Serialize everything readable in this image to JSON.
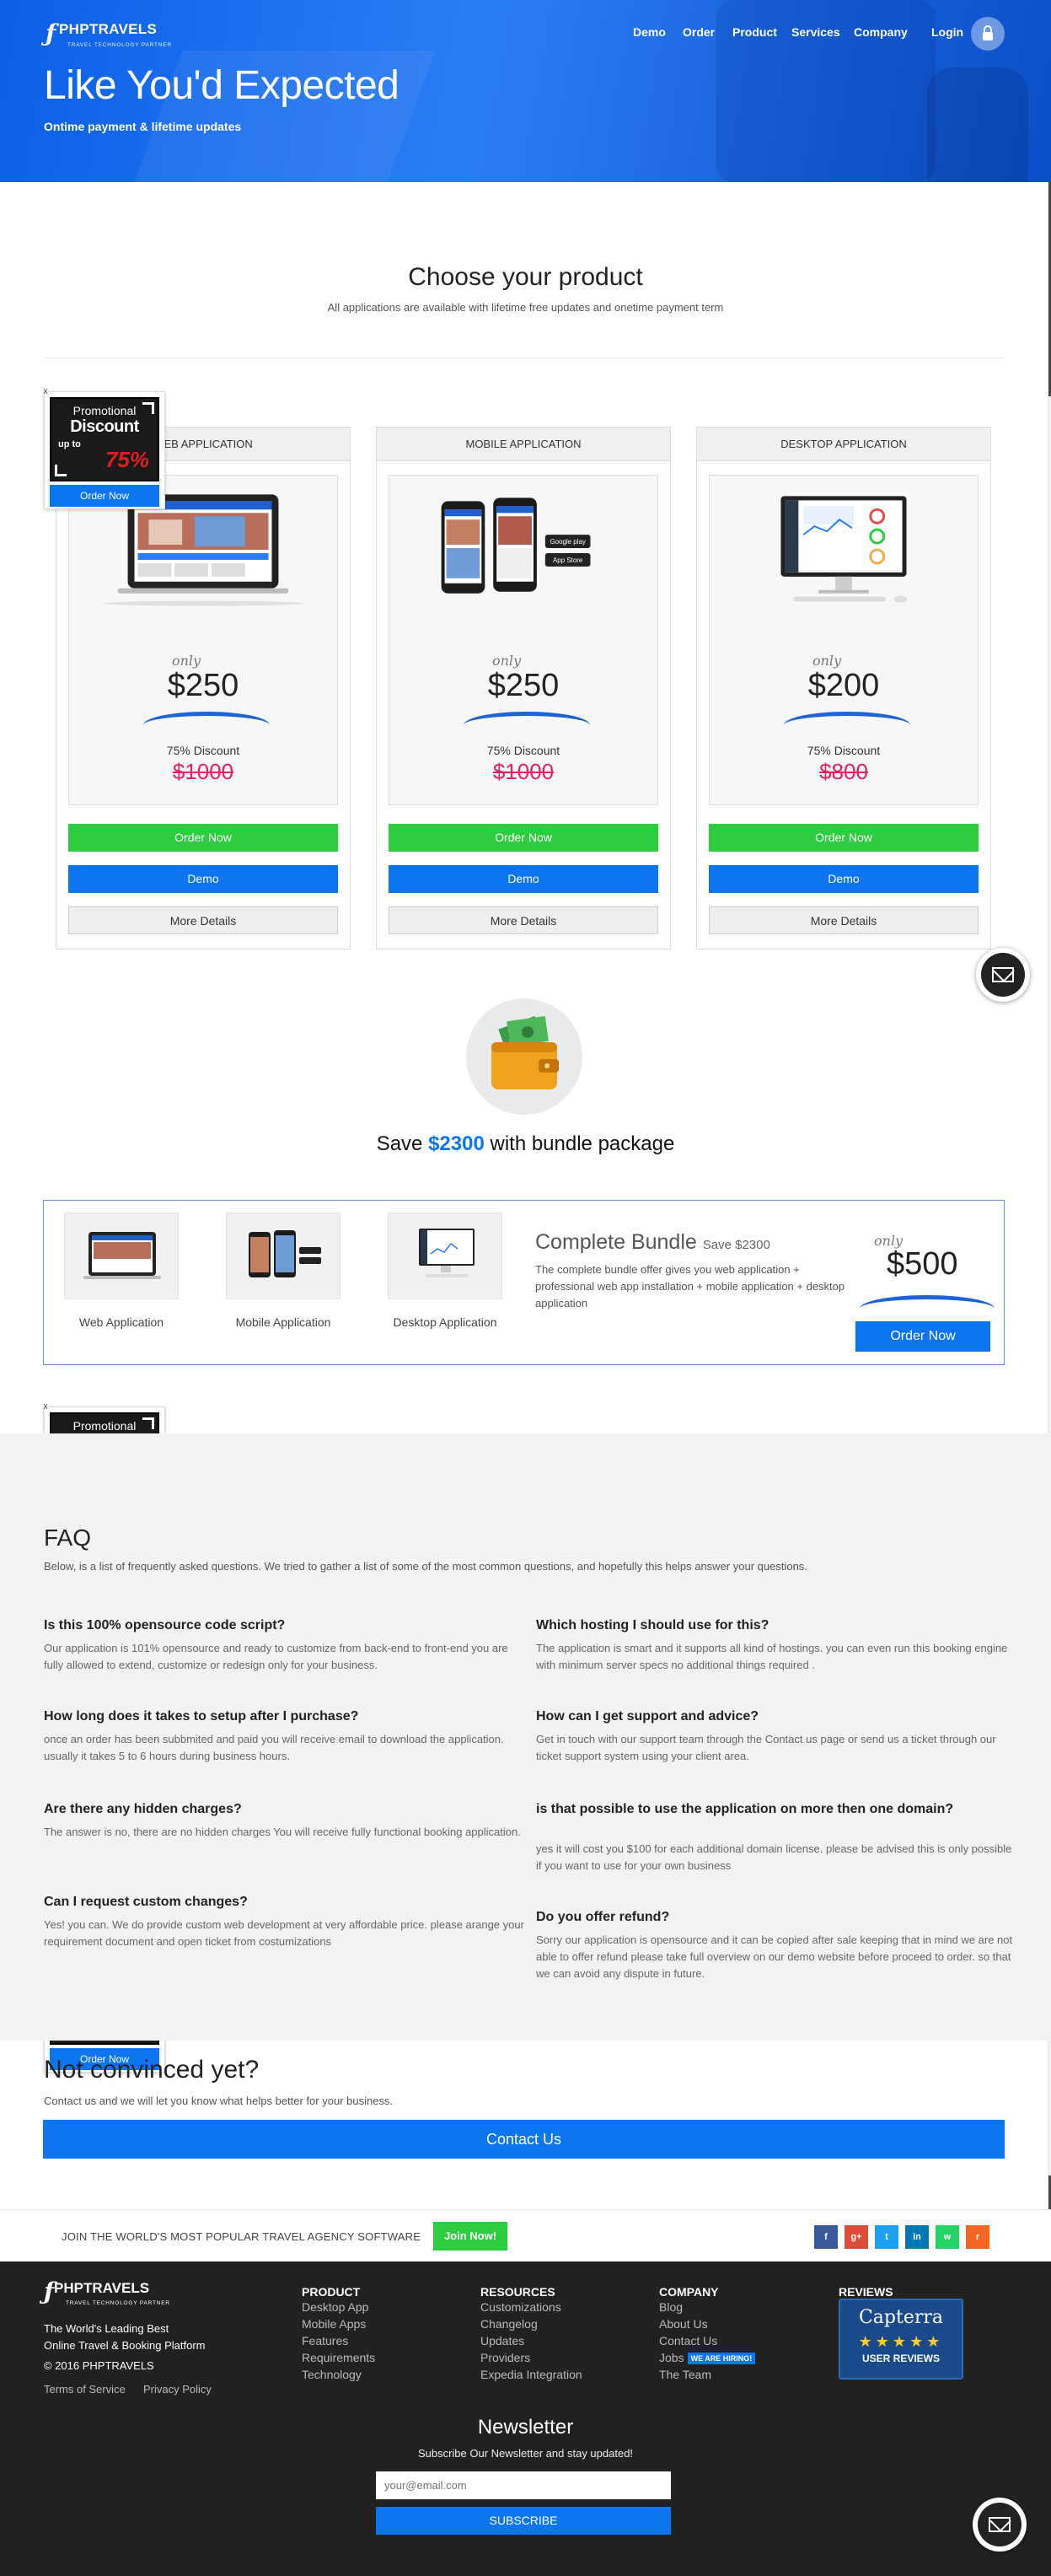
{
  "brand": {
    "name": "PHPTRAVELS",
    "tagline": "TRAVEL TECHNOLOGY PARTNER"
  },
  "nav": {
    "items": [
      "Demo",
      "Order",
      "Product",
      "Services",
      "Company"
    ],
    "login": "Login"
  },
  "hero": {
    "title": "Like You'd Expected",
    "subtitle": "Ontime payment & lifetime updates"
  },
  "products": {
    "title": "Choose your product",
    "subtitle": "All applications are available with lifetime free updates and onetime payment term",
    "cards": [
      {
        "name": "WEB APPLICATION",
        "only": "only",
        "price": "$250",
        "discount": "75% Discount",
        "old_price": "$1000",
        "order": "Order Now",
        "demo": "Demo",
        "details": "More Details"
      },
      {
        "name": "MOBILE APPLICATION",
        "only": "only",
        "price": "$250",
        "discount": "75% Discount",
        "old_price": "$1000",
        "order": "Order Now",
        "demo": "Demo",
        "details": "More Details"
      },
      {
        "name": "DESKTOP APPLICATION",
        "only": "only",
        "price": "$200",
        "discount": "75% Discount",
        "old_price": "$800",
        "order": "Order Now",
        "demo": "Demo",
        "details": "More Details"
      }
    ]
  },
  "promo": {
    "close": "x",
    "line1": "Promotional",
    "line2": "Discount",
    "line3": "up to",
    "percent": "75%",
    "button": "Order Now"
  },
  "bundle": {
    "save_prefix": "Save ",
    "save_amount": "$2300",
    "save_suffix": " with bundle package",
    "items": [
      "Web Application",
      "Mobile Application",
      "Desktop Application"
    ],
    "title": "Complete Bundle",
    "title_save": "Save $2300",
    "description": "The complete bundle offer gives you web application + professional web app installation + mobile application + desktop application",
    "only": "only",
    "price": "$500",
    "button": "Order Now"
  },
  "faq": {
    "title": "FAQ",
    "intro": "Below, is a list of frequently asked questions. We tried to gather a list of some of the most common questions, and hopefully this helps answer your questions.",
    "items": [
      {
        "q": "Is this 100% opensource code script?",
        "a": "Our application is 101% opensource and ready to customize from back-end to front-end you are fully allowed to extend, customize or redesign only for your business."
      },
      {
        "q": "Which hosting I should use for this?",
        "a": "The application is smart and it supports all kind of hostings. you can even run this booking engine with minimum server specs no additional things required ."
      },
      {
        "q": "How long does it takes to setup after I purchase?",
        "a": "once an order has been subbmited and paid you will receive email to download the application. usually it takes 5 to 6 hours during business hours."
      },
      {
        "q": "How can I get support and advice?",
        "a": "Get in touch with our support team through the Contact us page or send us a ticket through our ticket support system using your client area."
      },
      {
        "q": "Are there any hidden charges?",
        "a": "The answer is no, there are no hidden charges You will receive fully functional booking application."
      },
      {
        "q": "is that possible to use the application on more then one domain?",
        "a": "yes it will cost you $100 for each additional domain license. please be advised this is only possible if you want to use for your own business"
      },
      {
        "q": "Can I request custom changes?",
        "a": "Yes! you can. We do provide custom web development at very affordable price. please arange your requirement document and open ticket from costumizations"
      },
      {
        "q": "Do you offer refund?",
        "a": "Sorry our application is opensource and it can be copied after sale keeping that in mind we are not able to offer refund please take full overview on our demo website before proceed to order. so that we can avoid any dispute in future."
      }
    ]
  },
  "convinced": {
    "title": "Not convinced yet?",
    "subtitle": "Contact us and we will let you know what helps better for your business.",
    "button": "Contact Us"
  },
  "join": {
    "text": "JOIN THE WORLD'S MOST POPULAR TRAVEL AGENCY SOFTWARE",
    "button": "Join Now!"
  },
  "social": [
    {
      "icon": "facebook-icon",
      "glyph": "f",
      "color": "#3b5998"
    },
    {
      "icon": "google-plus-icon",
      "glyph": "g+",
      "color": "#dd4b39"
    },
    {
      "icon": "twitter-icon",
      "glyph": "t",
      "color": "#1da1f2"
    },
    {
      "icon": "linkedin-icon",
      "glyph": "in",
      "color": "#0077b5"
    },
    {
      "icon": "whatsapp-icon",
      "glyph": "w",
      "color": "#25d366"
    },
    {
      "icon": "rss-icon",
      "glyph": "r",
      "color": "#f26522"
    }
  ],
  "footer": {
    "tagline1": "The World's Leading Best",
    "tagline2": "Online Travel & Booking Platform",
    "copyright": "© 2016 PHPTRAVELS",
    "terms": "Terms of Service",
    "privacy": "Privacy Policy",
    "columns": [
      {
        "title": "PRODUCT",
        "items": [
          "Desktop App",
          "Mobile Apps",
          "Features",
          "Requirements",
          "Technology"
        ]
      },
      {
        "title": "RESOURCES",
        "items": [
          "Customizations",
          "Changelog",
          "Updates",
          "Providers",
          "Expedia Integration"
        ]
      },
      {
        "title": "COMPANY",
        "items": [
          "Blog",
          "About Us",
          "Contact Us",
          "Jobs",
          "The Team"
        ]
      }
    ],
    "hiring": "WE ARE HIRING!",
    "reviews": "REVIEWS",
    "capterra": "Capterra",
    "capterra_stars": "★★★★★",
    "capterra_reviews": "USER REVIEWS"
  },
  "newsletter": {
    "title": "Newsletter",
    "subtitle": "Subscribe Our Newsletter and stay updated!",
    "placeholder": "your@email.com",
    "button": "SUBSCRIBE"
  },
  "colors": {
    "primary": "#0d75ef",
    "green": "#2ecc40",
    "strike": "#e0245e",
    "footer_bg": "#212121"
  }
}
